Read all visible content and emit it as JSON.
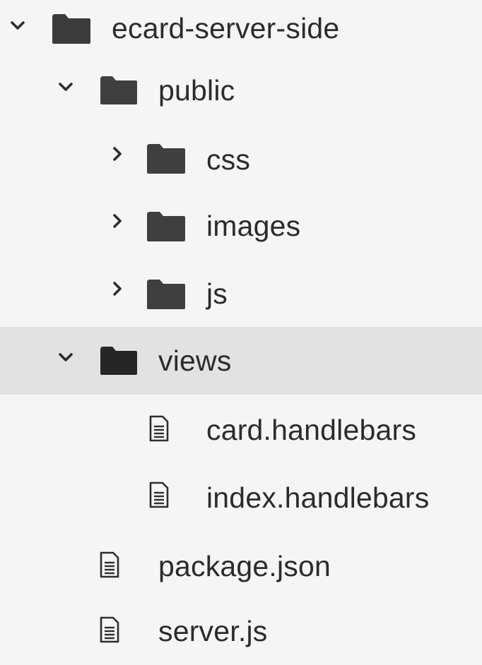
{
  "tree": {
    "root": {
      "label": "ecard-server-side",
      "expanded": true,
      "icon": "folder-icon"
    },
    "public": {
      "label": "public",
      "expanded": true,
      "icon": "folder-icon"
    },
    "css": {
      "label": "css",
      "expanded": false,
      "icon": "folder-icon"
    },
    "images": {
      "label": "images",
      "expanded": false,
      "icon": "folder-icon"
    },
    "js": {
      "label": "js",
      "expanded": false,
      "icon": "folder-icon"
    },
    "views": {
      "label": "views",
      "expanded": true,
      "selected": true,
      "icon": "folder-icon"
    },
    "card": {
      "label": "card.handlebars",
      "icon": "file-icon"
    },
    "index": {
      "label": "index.handlebars",
      "icon": "file-icon"
    },
    "package": {
      "label": "package.json",
      "icon": "file-icon"
    },
    "server": {
      "label": "server.js",
      "icon": "file-icon"
    }
  },
  "colors": {
    "background": "#f5f5f5",
    "selected_row": "#e2e2e2",
    "folder": "#3a3a3a",
    "text": "#2b2b2b"
  }
}
